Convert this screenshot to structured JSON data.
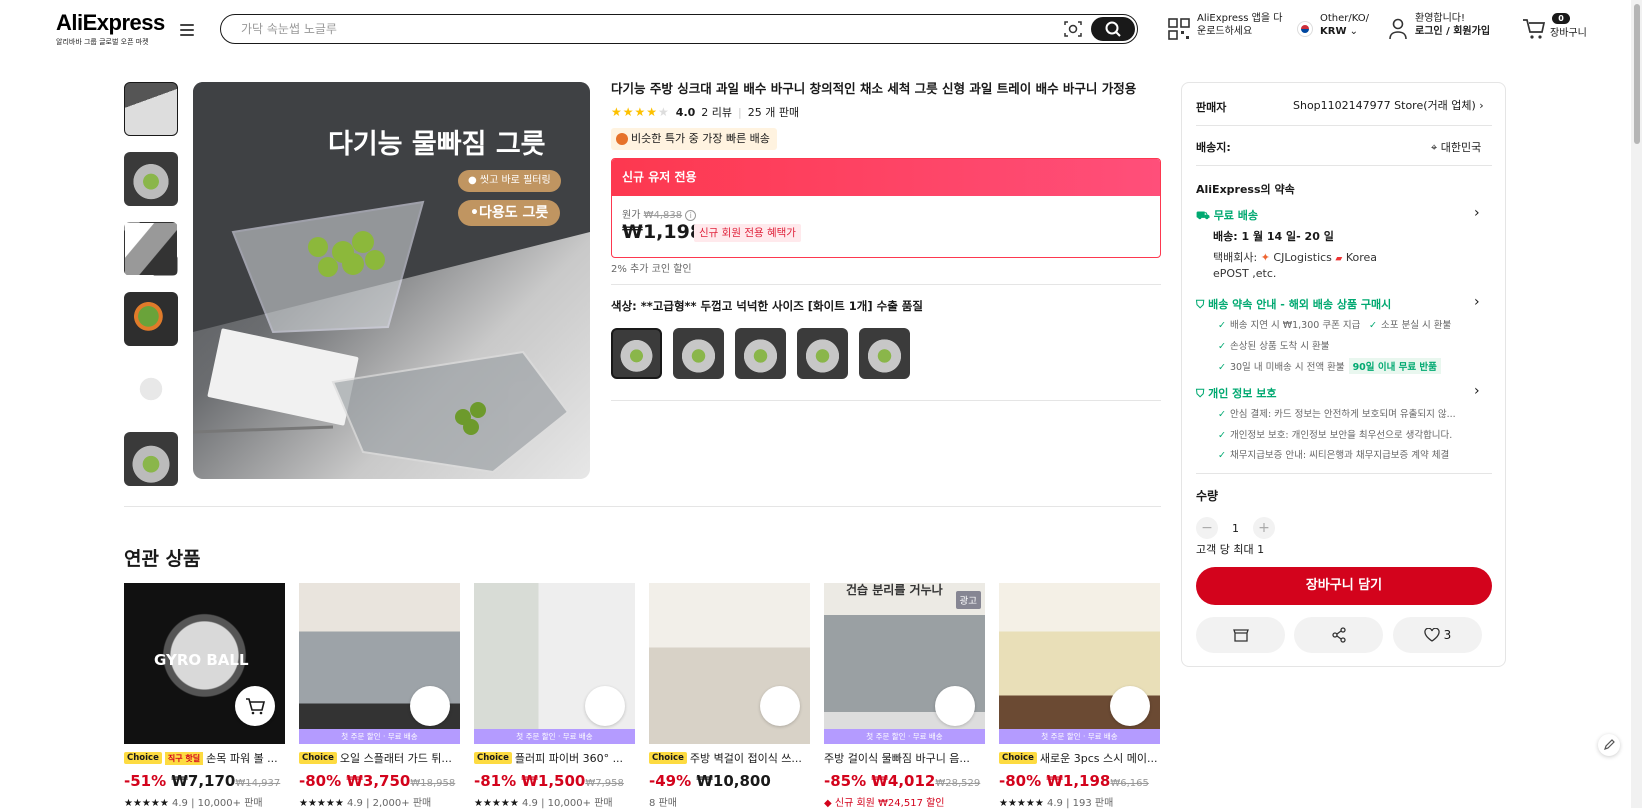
{
  "header": {
    "logo": "AliExpress",
    "logo_tagline": "알리바바 그룹 글로벌 오픈 마켓",
    "search_placeholder": "가닥 속눈썹 노글루",
    "app_promo_line1": "AliExpress 앱을 다",
    "app_promo_line2": "운로드하세요",
    "region_line1": "Other/KO/",
    "region_line2": "KRW",
    "greeting_line1": "환영합니다!",
    "greeting_line2": "로그인 / 회원가입",
    "cart_count": "0",
    "cart_label": "장바구니"
  },
  "product": {
    "title": "다기능 주방 싱크대 과일 배수 바구니 창의적인 채소 세척 그릇 신형 과일 트레이 배수 바구니 가정용",
    "rating": "4.0",
    "reviews": "2 리뷰",
    "sold": "25 개 판매",
    "deal_badge": "비슷한 특가 중 가장 빠른 배송",
    "promo_bar": "신규 유저 전용",
    "original_label": "원가",
    "original_price": "₩4,838",
    "price": "₩1,198",
    "new_member_tag": "신규 회원 전용 혜택가",
    "coin_note": "2% 추가 코인 할인",
    "color_label": "색상: **고급형** 두껍고 넉넉한 사이즈 [화이트 1개] 수출 품질",
    "main_image_text": "다기능 물빠짐 그릇",
    "main_image_pill1": "씻고 바로 필터링",
    "main_image_pill2": "•다용도 그릇"
  },
  "seller": {
    "label": "판매자",
    "name": "Shop1102147977 Store(거래 업체)",
    "ship_to_label": "배송지:",
    "ship_to": "대한민국",
    "promise_title": "AliExpress의 약속",
    "free_ship": "무료 배송",
    "delivery": "배송: 1 월 14 일- 20 일",
    "carrier_line1": "택배회사: ",
    "carrier_name": "CJLogistics",
    "carrier_name2": "Korea",
    "carrier_line2": "ePOST ,etc.",
    "ship_promise": "배송 약속 안내 - 해외 배송 상품 구매시",
    "checks1": [
      "배송 지연 시 ₩1,300 쿠폰 지급",
      "소포 분실 시 환불",
      "손상된 상품 도착 시 환불",
      "30일 내 미배송 시 전액 환불"
    ],
    "tag90": "90일 이내 무료 반품",
    "privacy": "개인 정보 보호",
    "checks2": [
      "안심 결제: 카드 정보는 안전하게 보호되며 유출되지 않...",
      "개인정보 보호: 개인정보 보안을 최우선으로 생각합니다.",
      "채무지급보증 안내: 씨티은행과 채무지급보증 계약 체결"
    ],
    "qty_label": "수량",
    "qty_value": "1",
    "qty_limit": "고객 당 최대 1",
    "add_to_cart": "장바구니 담기",
    "wish_count": "3"
  },
  "related": {
    "title": "연관 상품",
    "choice": "Choice",
    "jik": "직구 핫딜",
    "banner": "첫 주문 할인 · 무료 배송",
    "ad": "광고",
    "items": [
      {
        "title": "손목 파워 볼 ...",
        "disc": "-51%",
        "price": "₩7,170",
        "orig": "₩14,937",
        "meta": "4.9 | 10,000+ 판매",
        "img": "GYRO BALL"
      },
      {
        "title": "오일 스플래터 가드 튀...",
        "disc": "-80%",
        "price": "₩3,750",
        "orig": "₩18,958",
        "meta": "4.9 | 2,000+ 판매"
      },
      {
        "title": "플러피 파이버 360° ...",
        "disc": "-81%",
        "price": "₩1,500",
        "orig": "₩7,958",
        "meta": "4.9 | 10,000+ 판매"
      },
      {
        "title": "주방 벽걸이 접이식 쓰...",
        "disc": "-49%",
        "price": "₩10,800",
        "orig": "",
        "meta": "8 판매"
      },
      {
        "title": "주방 걸이식 물빠짐 바구니 음...",
        "disc": "-85%",
        "price": "₩4,012",
        "orig": "₩28,529",
        "meta": "신규 회원 ₩24,517 할인",
        "top_text": "건습 분리를 거누나"
      },
      {
        "title": "새로운 3pcs 스시 메이...",
        "disc": "-80%",
        "price": "₩1,198",
        "orig": "₩6,165",
        "meta": "4.9 | 193 판매"
      }
    ]
  }
}
